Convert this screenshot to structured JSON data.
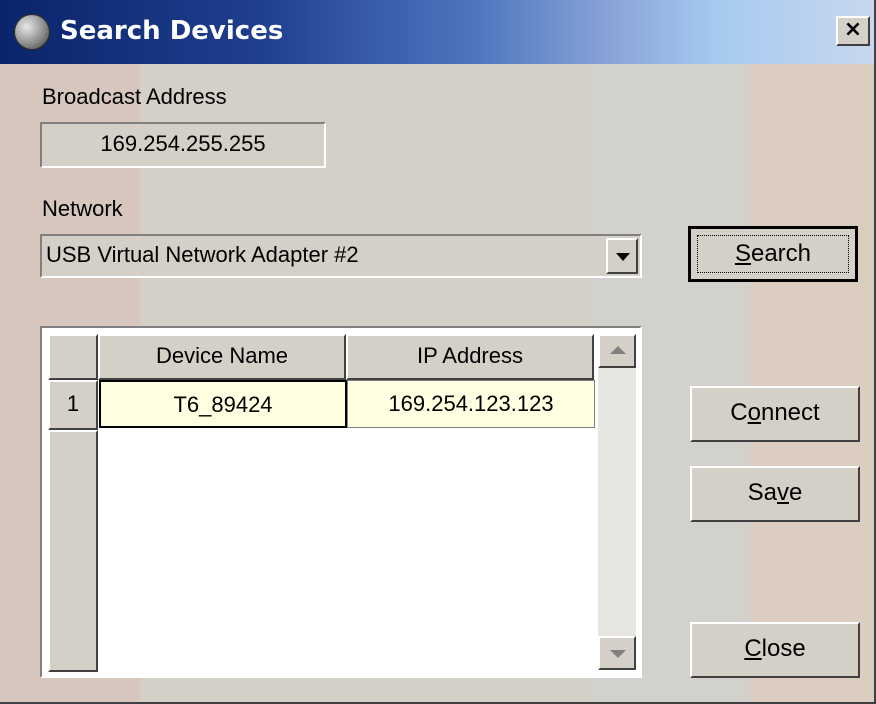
{
  "window": {
    "title": "Search Devices",
    "close_label": "×"
  },
  "broadcast": {
    "label": "Broadcast Address",
    "value": "169.254.255.255"
  },
  "network": {
    "label": "Network",
    "selected": "USB Virtual Network Adapter #2"
  },
  "buttons": {
    "search": {
      "pre": "",
      "mnemonic": "S",
      "post": "earch"
    },
    "connect": {
      "pre": "C",
      "mnemonic": "o",
      "post": "nnect"
    },
    "save": {
      "pre": "Sa",
      "mnemonic": "v",
      "post": "e"
    },
    "close": {
      "pre": "",
      "mnemonic": "C",
      "post": "lose"
    }
  },
  "device_table": {
    "columns": [
      "Device Name",
      "IP Address"
    ],
    "rows": [
      {
        "index": "1",
        "device_name": "T6_89424",
        "ip_address": "169.254.123.123"
      }
    ]
  },
  "icons": {
    "app": "globe-icon",
    "close": "close-icon",
    "dropdown": "chevron-down-icon",
    "scroll_up": "arrow-up-icon",
    "scroll_down": "arrow-down-icon"
  }
}
